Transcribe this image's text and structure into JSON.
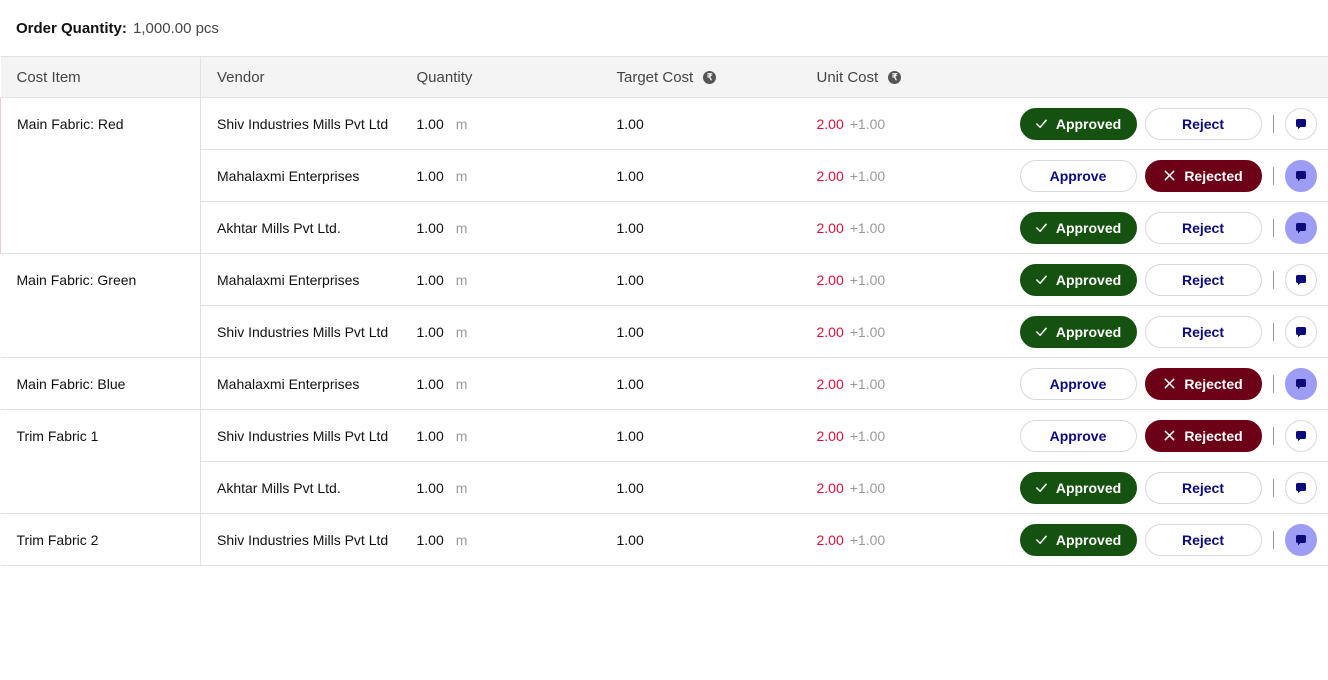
{
  "order": {
    "label": "Order Quantity:",
    "value": "1,000.00 pcs"
  },
  "headers": {
    "cost_item": "Cost Item",
    "vendor": "Vendor",
    "quantity": "Quantity",
    "target_cost": "Target Cost",
    "unit_cost": "Unit Cost",
    "info_icon": "₹"
  },
  "labels": {
    "approved": "Approved",
    "reject": "Reject",
    "approve": "Approve",
    "rejected": "Rejected"
  },
  "colors": {
    "approved_bg": "#16520f",
    "rejected_bg": "#6b0016",
    "outline_text": "#0a0a7a",
    "unit_cost": "#e0103a",
    "chat_active": "#9d9df5"
  },
  "groups": [
    {
      "item": "Main Fabric: Red",
      "rows": [
        {
          "vendor": "Shiv Industries Mills Pvt Ltd",
          "qty": "1.00",
          "unit": "m",
          "target": "1.00",
          "unit_cost": "2.00",
          "delta": "+1.00",
          "status": "approved",
          "chat_active": false
        },
        {
          "vendor": "Mahalaxmi Enterprises",
          "qty": "1.00",
          "unit": "m",
          "target": "1.00",
          "unit_cost": "2.00",
          "delta": "+1.00",
          "status": "rejected",
          "chat_active": true
        },
        {
          "vendor": "Akhtar Mills Pvt Ltd.",
          "qty": "1.00",
          "unit": "m",
          "target": "1.00",
          "unit_cost": "2.00",
          "delta": "+1.00",
          "status": "approved",
          "chat_active": true
        }
      ]
    },
    {
      "item": "Main Fabric: Green",
      "rows": [
        {
          "vendor": "Mahalaxmi Enterprises",
          "qty": "1.00",
          "unit": "m",
          "target": "1.00",
          "unit_cost": "2.00",
          "delta": "+1.00",
          "status": "approved",
          "chat_active": false
        },
        {
          "vendor": "Shiv Industries Mills Pvt Ltd",
          "qty": "1.00",
          "unit": "m",
          "target": "1.00",
          "unit_cost": "2.00",
          "delta": "+1.00",
          "status": "approved",
          "chat_active": false
        }
      ]
    },
    {
      "item": "Main Fabric: Blue",
      "rows": [
        {
          "vendor": "Mahalaxmi Enterprises",
          "qty": "1.00",
          "unit": "m",
          "target": "1.00",
          "unit_cost": "2.00",
          "delta": "+1.00",
          "status": "rejected",
          "chat_active": true
        }
      ]
    },
    {
      "item": "Trim Fabric 1",
      "rows": [
        {
          "vendor": "Shiv Industries Mills Pvt Ltd",
          "qty": "1.00",
          "unit": "m",
          "target": "1.00",
          "unit_cost": "2.00",
          "delta": "+1.00",
          "status": "rejected",
          "chat_active": false
        },
        {
          "vendor": "Akhtar Mills Pvt Ltd.",
          "qty": "1.00",
          "unit": "m",
          "target": "1.00",
          "unit_cost": "2.00",
          "delta": "+1.00",
          "status": "approved",
          "chat_active": false
        }
      ]
    },
    {
      "item": "Trim Fabric 2",
      "rows": [
        {
          "vendor": "Shiv Industries Mills Pvt Ltd",
          "qty": "1.00",
          "unit": "m",
          "target": "1.00",
          "unit_cost": "2.00",
          "delta": "+1.00",
          "status": "approved",
          "chat_active": true
        }
      ]
    }
  ]
}
